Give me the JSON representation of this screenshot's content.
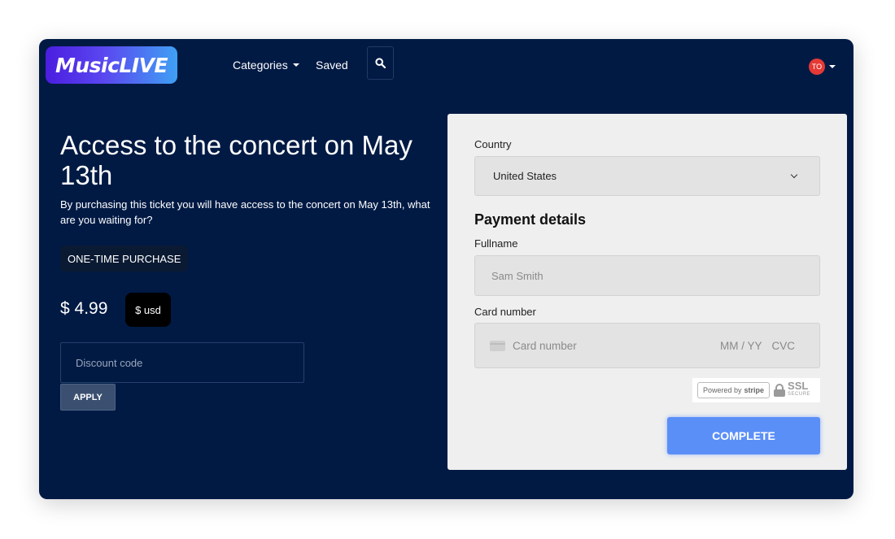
{
  "brand": {
    "logo_text": "MusicLIVE"
  },
  "nav": {
    "categories_label": "Categories",
    "saved_label": "Saved",
    "search_icon": "search-icon",
    "avatar_initials": "TO"
  },
  "product": {
    "title": "Access to the concert on May 13th",
    "description": "By purchasing this ticket you will have access to the concert on May 13th, what are you waiting for?",
    "badge": "ONE-TIME PURCHASE",
    "price": "$ 4.99",
    "currency": "$ usd"
  },
  "discount": {
    "placeholder": "Discount code",
    "apply_label": "APPLY"
  },
  "payment": {
    "country_label": "Country",
    "country_value": "United States",
    "section_title": "Payment details",
    "fullname_label": "Fullname",
    "fullname_placeholder": "Sam Smith",
    "card_label": "Card number",
    "card_placeholder": "Card number",
    "expiry_placeholder": "MM / YY",
    "cvc_placeholder": "CVC",
    "powered_by": "Powered by",
    "stripe_brand": "stripe",
    "ssl_text": "SSL",
    "ssl_subtext": "SECURE",
    "complete_label": "COMPLETE"
  },
  "colors": {
    "background": "#001a44",
    "card": "#efefef",
    "accent": "#5b8ff8",
    "avatar": "#e53935"
  }
}
